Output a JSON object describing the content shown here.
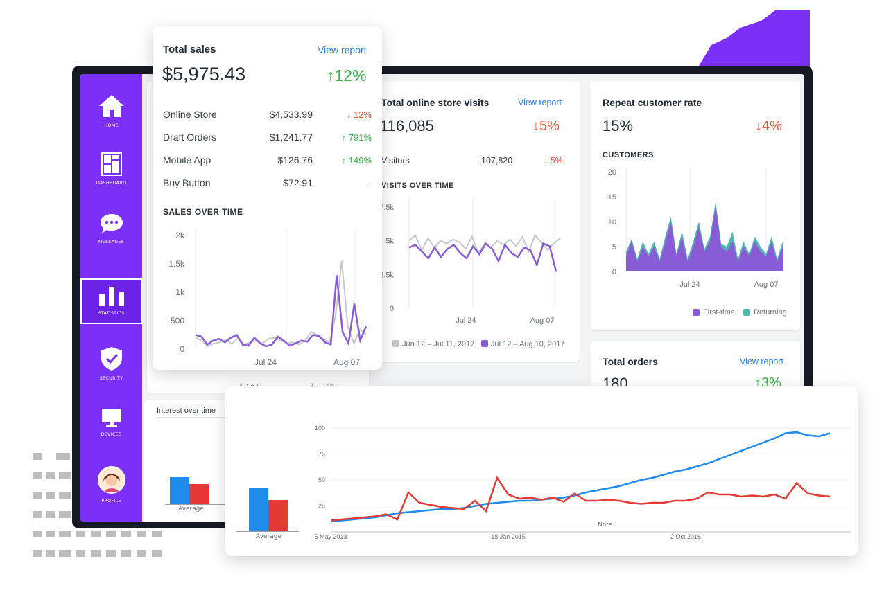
{
  "colors": {
    "accent": "#7b2ff7",
    "purple_series": "#8a5bd6",
    "grey_series": "#c4c8cc",
    "teal_series": "#4cb8b0",
    "trend_blue": "#1f8ceb",
    "trend_red": "#e53935",
    "up_green": "#3bb54a",
    "down_red": "#e5583b"
  },
  "sidebar": {
    "items": [
      {
        "label": "HOME",
        "icon": "home-icon"
      },
      {
        "label": "DASHBOARD",
        "icon": "dashboard-icon"
      },
      {
        "label": "MESSAGES",
        "icon": "chat-bubble-icon"
      },
      {
        "label": "STATISTICS",
        "icon": "bar-chart-icon",
        "active": true
      },
      {
        "label": "SECURITY",
        "icon": "shield-check-icon"
      },
      {
        "label": "DEVICES",
        "icon": "monitor-icon"
      },
      {
        "label": "PROFILE",
        "icon": "avatar-icon"
      }
    ]
  },
  "total_sales": {
    "title": "Total sales",
    "link": "View report",
    "value": "$5,975.43",
    "change": "↑12%",
    "rows": [
      {
        "label": "Online Store",
        "value": "$4,533.99",
        "change": "↓ 12%",
        "direction": "down"
      },
      {
        "label": "Draft Orders",
        "value": "$1,241.77",
        "change": "↑ 791%",
        "direction": "up"
      },
      {
        "label": "Mobile App",
        "value": "$126.76",
        "change": "↑ 149%",
        "direction": "up"
      },
      {
        "label": "Buy Button",
        "value": "$72.91",
        "change": "-",
        "direction": "none"
      }
    ],
    "chart_heading": "SALES OVER TIME",
    "behind_x_ticks": [
      "Jul 24",
      "Aug 07"
    ]
  },
  "visits": {
    "title": "Total online store visits",
    "link": "View report",
    "value": "116,085",
    "change": "↓5%",
    "row": {
      "label": "Visitors",
      "value": "107,820",
      "change": "↓ 5%"
    },
    "chart_heading": "VISITS OVER TIME",
    "legend": [
      "Jun 12 – Jul 11, 2017",
      "Jul 12 – Aug 10, 2017"
    ]
  },
  "repeat": {
    "title": "Repeat customer rate",
    "value": "15%",
    "change": "↓4%",
    "chart_heading": "CUSTOMERS",
    "legend": [
      "First-time",
      "Returning"
    ]
  },
  "orders": {
    "title": "Total orders",
    "link": "View report",
    "value": "180",
    "change": "↑3%"
  },
  "interest": {
    "title": "Interest over time",
    "bar_label": "Average"
  },
  "trends": {
    "bar_label": "Average",
    "note_label": "Note"
  },
  "chart_data": [
    {
      "type": "line",
      "title": "SALES OVER TIME",
      "x_ticks": [
        "Jul 24",
        "Aug 07"
      ],
      "y_ticks": [
        "2k",
        "1.5k",
        "1k",
        "500",
        "0"
      ],
      "ylim": [
        0,
        2000
      ],
      "series": [
        {
          "values": [
            200,
            150,
            50,
            100,
            120,
            160,
            90,
            200,
            80,
            120,
            150,
            100,
            180,
            200,
            150,
            100,
            120,
            80,
            150,
            300,
            250,
            180,
            120,
            600,
            1550,
            400,
            100,
            350,
            250
          ]
        },
        {
          "values": [
            250,
            220,
            80,
            150,
            180,
            120,
            200,
            250,
            80,
            60,
            200,
            100,
            50,
            80,
            220,
            150,
            60,
            100,
            150,
            130,
            250,
            230,
            120,
            80,
            1300,
            300,
            100,
            800,
            150,
            400
          ]
        }
      ]
    },
    {
      "type": "line",
      "title": "VISITS OVER TIME",
      "x_ticks": [
        "Jul 24",
        "Aug 07"
      ],
      "y_ticks": [
        "7.5k",
        "5k",
        "2.5k",
        "0"
      ],
      "ylim": [
        0,
        7500
      ],
      "series": [
        {
          "name": "Jun 12 – Jul 11, 2017",
          "values": [
            5000,
            5400,
            4300,
            5200,
            4500,
            5000,
            4800,
            5100,
            4900,
            4400,
            5300,
            4100,
            4800,
            4500,
            5000,
            4700,
            5100,
            4600,
            5300,
            4200,
            5400,
            4900,
            4300,
            4800,
            5200
          ]
        },
        {
          "name": "Jul 12 – Aug 10, 2017",
          "values": [
            4500,
            4700,
            4200,
            3700,
            4500,
            3800,
            4400,
            4700,
            4100,
            3700,
            4600,
            4000,
            4800,
            4400,
            3500,
            4700,
            4100,
            3800,
            4500,
            4300,
            3200,
            4800,
            4600,
            2700
          ]
        }
      ]
    },
    {
      "type": "area",
      "title": "CUSTOMERS",
      "x_ticks": [
        "Jul 24",
        "Aug 07"
      ],
      "y_ticks": [
        "20",
        "15",
        "10",
        "5",
        "0"
      ],
      "ylim": [
        0,
        20
      ],
      "series": [
        {
          "name": "First-time",
          "values": [
            3,
            6,
            2,
            5,
            3,
            5,
            2,
            6,
            10,
            3,
            7,
            2,
            5,
            9,
            4,
            6,
            13,
            5,
            4,
            6,
            2,
            5,
            3,
            6,
            4,
            3,
            6,
            2,
            5
          ]
        },
        {
          "name": "Returning",
          "values": [
            1,
            0.5,
            0.5,
            1,
            0.5,
            1,
            0.5,
            1,
            1,
            0.5,
            1,
            0.5,
            1,
            1,
            0.5,
            1,
            1,
            0.5,
            1,
            2,
            0.5,
            1,
            0.5,
            1,
            1,
            0.5,
            1,
            0.5,
            1
          ]
        }
      ]
    },
    {
      "type": "line",
      "title": "",
      "x_ticks": [
        "5 May 2013",
        "18 Jan 2015",
        "2 Oct 2016"
      ],
      "y_ticks": [
        "100",
        "75",
        "50",
        "25"
      ],
      "ylim": [
        0,
        100
      ],
      "series": [
        {
          "values": [
            10,
            11,
            12,
            13,
            14,
            16,
            18,
            19,
            20,
            21,
            22,
            22,
            23,
            25,
            27,
            28,
            29,
            30,
            30,
            31,
            32,
            33,
            35,
            38,
            40,
            42,
            44,
            47,
            50,
            52,
            55,
            58,
            60,
            63,
            66,
            70,
            74,
            78,
            82,
            86,
            90,
            95,
            96,
            93,
            92,
            95
          ]
        },
        {
          "values": [
            11,
            12,
            13,
            14,
            15,
            17,
            12,
            38,
            28,
            26,
            24,
            23,
            22,
            30,
            20,
            52,
            36,
            32,
            33,
            31,
            33,
            29,
            37,
            30,
            30,
            31,
            30,
            28,
            27,
            28,
            28,
            30,
            30,
            32,
            38,
            36,
            36,
            34,
            35,
            34,
            36,
            32,
            47,
            37,
            35,
            34
          ]
        }
      ]
    },
    {
      "type": "bar",
      "title": "",
      "categories": [
        "Average"
      ],
      "series": [
        {
          "values": [
            43
          ]
        },
        {
          "values": [
            31
          ]
        }
      ]
    }
  ]
}
